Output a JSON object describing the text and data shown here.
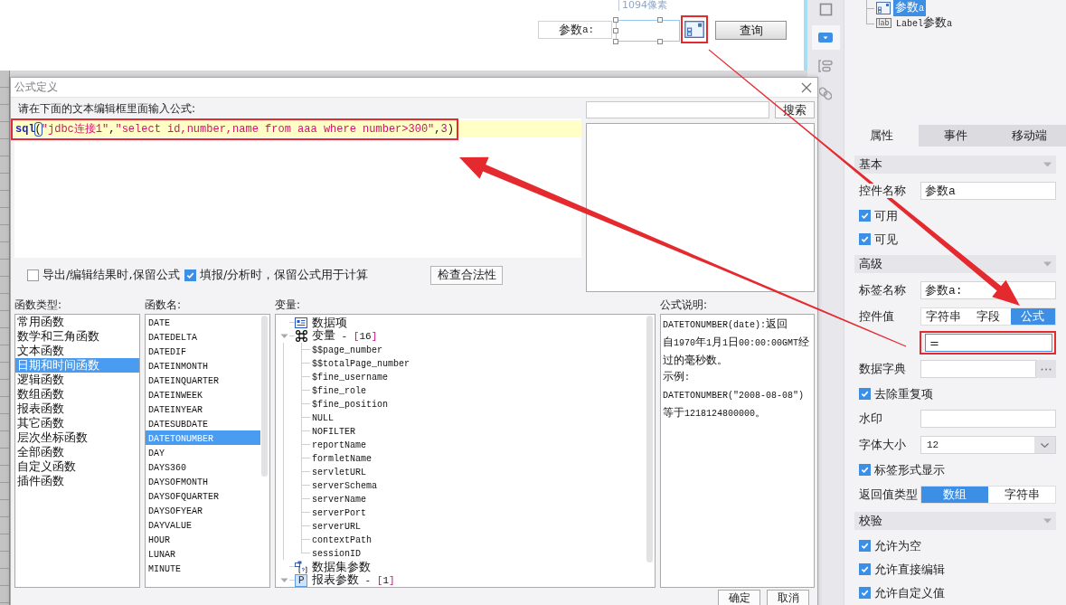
{
  "canvas": {
    "ruler_label": "1094像素",
    "param_label": "参数a:",
    "picker_highlighted": true,
    "query_button": "查询"
  },
  "dialog": {
    "title": "公式定义",
    "instruction": "请在下面的文本编辑框里面输入公式:",
    "formula": {
      "highlighted": true,
      "segments": [
        {
          "kind": "function",
          "text": "sql"
        },
        {
          "kind": "matched-bracket",
          "text": "("
        },
        {
          "kind": "string",
          "text": "\"jdbc连接1\""
        },
        {
          "kind": "punct",
          "text": ","
        },
        {
          "kind": "string",
          "text": "\"select id,number,name from aaa where number>300\""
        },
        {
          "kind": "punct",
          "text": ","
        },
        {
          "kind": "number",
          "text": "3"
        },
        {
          "kind": "punct",
          "text": ")"
        }
      ]
    },
    "search_button": "搜索",
    "options": [
      {
        "label": "导出/编辑结果时,保留公式",
        "checked": false
      },
      {
        "label": "填报/分析时，保留公式用于计算",
        "checked": true
      }
    ],
    "validate_button": "检查合法性",
    "function_types": {
      "title": "函数类型:",
      "items": [
        {
          "label": "常用函数",
          "selected": false
        },
        {
          "label": "数学和三角函数",
          "selected": false
        },
        {
          "label": "文本函数",
          "selected": false
        },
        {
          "label": "日期和时间函数",
          "selected": true
        },
        {
          "label": "逻辑函数",
          "selected": false
        },
        {
          "label": "数组函数",
          "selected": false
        },
        {
          "label": "报表函数",
          "selected": false
        },
        {
          "label": "其它函数",
          "selected": false
        },
        {
          "label": "层次坐标函数",
          "selected": false
        },
        {
          "label": "全部函数",
          "selected": false
        },
        {
          "label": "自定义函数",
          "selected": false
        },
        {
          "label": "插件函数",
          "selected": false
        }
      ]
    },
    "function_names": {
      "title": "函数名:",
      "items": [
        {
          "label": "DATE",
          "selected": false
        },
        {
          "label": "DATEDELTA",
          "selected": false
        },
        {
          "label": "DATEDIF",
          "selected": false
        },
        {
          "label": "DATEINMONTH",
          "selected": false
        },
        {
          "label": "DATEINQUARTER",
          "selected": false
        },
        {
          "label": "DATEINWEEK",
          "selected": false
        },
        {
          "label": "DATEINYEAR",
          "selected": false
        },
        {
          "label": "DATESUBDATE",
          "selected": false
        },
        {
          "label": "DATETONUMBER",
          "selected": true
        },
        {
          "label": "DAY",
          "selected": false
        },
        {
          "label": "DAYS360",
          "selected": false
        },
        {
          "label": "DAYSOFMONTH",
          "selected": false
        },
        {
          "label": "DAYSOFQUARTER",
          "selected": false
        },
        {
          "label": "DAYSOFYEAR",
          "selected": false
        },
        {
          "label": "DAYVALUE",
          "selected": false
        },
        {
          "label": "HOUR",
          "selected": false
        },
        {
          "label": "LUNAR",
          "selected": false
        },
        {
          "label": "MINUTE",
          "selected": false
        }
      ]
    },
    "variables": {
      "title": "变量:",
      "tree": [
        {
          "kind": "data",
          "label": "数据项"
        },
        {
          "kind": "variables",
          "label": "变量 - [16]",
          "expanded": true,
          "children": [
            {
              "label": "$$page_number"
            },
            {
              "label": "$$totalPage_number"
            },
            {
              "label": "$fine_username"
            },
            {
              "label": "$fine_role"
            },
            {
              "label": "$fine_position"
            },
            {
              "label": "NULL"
            },
            {
              "label": "NOFILTER"
            },
            {
              "label": "reportName"
            },
            {
              "label": "formletName"
            },
            {
              "label": "servletURL"
            },
            {
              "label": "serverSchema"
            },
            {
              "label": "serverName"
            },
            {
              "label": "serverPort"
            },
            {
              "label": "serverURL"
            },
            {
              "label": "contextPath"
            },
            {
              "label": "sessionID"
            }
          ]
        },
        {
          "kind": "dataset",
          "label": "数据集参数"
        },
        {
          "kind": "parameters",
          "badge": "P",
          "label": "报表参数 - [1]",
          "expanded": true
        }
      ]
    },
    "description": {
      "title": "公式说明:",
      "lines": [
        "DATETONUMBER(date):返回",
        "自1970年1月1日00:00:00GMT经",
        "过的毫秒数。",
        "示例:",
        "DATETONUMBER(\"2008-08-08\")",
        "等于1218124800000。"
      ]
    },
    "buttons": [
      "确定",
      "取消"
    ]
  },
  "toolbar": [
    {
      "kind": "frame",
      "selected": false
    },
    {
      "kind": "dropdown",
      "selected": true
    },
    {
      "kind": "layout",
      "selected": false
    },
    {
      "kind": "link",
      "selected": false
    }
  ],
  "object_tree": [
    {
      "kind": "combo",
      "label": "参数a",
      "selected": true
    },
    {
      "kind": "label",
      "badge": "lab",
      "label": "Label参数a",
      "selected": false
    }
  ],
  "property_tabs": [
    {
      "label": "属性",
      "selected": true
    },
    {
      "label": "事件",
      "selected": false
    },
    {
      "label": "移动端",
      "selected": false
    }
  ],
  "sections": [
    {
      "title": "基本",
      "expanded": true,
      "rows": [
        {
          "kind": "text",
          "label": "控件名称",
          "value": "参数a"
        },
        {
          "kind": "checkbox",
          "label": "可用",
          "checked": true
        },
        {
          "kind": "checkbox",
          "label": "可见",
          "checked": true
        }
      ]
    },
    {
      "title": "高级",
      "expanded": true,
      "rows": [
        {
          "kind": "text",
          "label": "标签名称",
          "value": "参数a:"
        },
        {
          "kind": "segmented",
          "label": "控件值",
          "options": [
            {
              "label": "字符串",
              "selected": false
            },
            {
              "label": "字段",
              "selected": false
            },
            {
              "label": "公式",
              "selected": true
            }
          ]
        },
        {
          "kind": "formula",
          "value": "=",
          "highlighted": true
        },
        {
          "kind": "picker",
          "label": "数据字典"
        },
        {
          "kind": "checkbox",
          "label": "去除重复项",
          "checked": true
        },
        {
          "kind": "text",
          "label": "水印"
        },
        {
          "kind": "select",
          "label": "字体大小",
          "value": "12"
        },
        {
          "kind": "checkbox",
          "label": "标签形式显示",
          "checked": true
        },
        {
          "kind": "segmented",
          "label": "返回值类型",
          "options": [
            {
              "label": "数组",
              "selected": true
            },
            {
              "label": "字符串",
              "selected": false
            }
          ]
        }
      ]
    },
    {
      "title": "校验",
      "expanded": true,
      "rows": [
        {
          "kind": "checkbox",
          "label": "允许为空",
          "checked": true
        },
        {
          "kind": "checkbox",
          "label": "允许直接编辑",
          "checked": true
        },
        {
          "kind": "checkbox",
          "label": "允许自定义值",
          "checked": true
        }
      ]
    }
  ]
}
